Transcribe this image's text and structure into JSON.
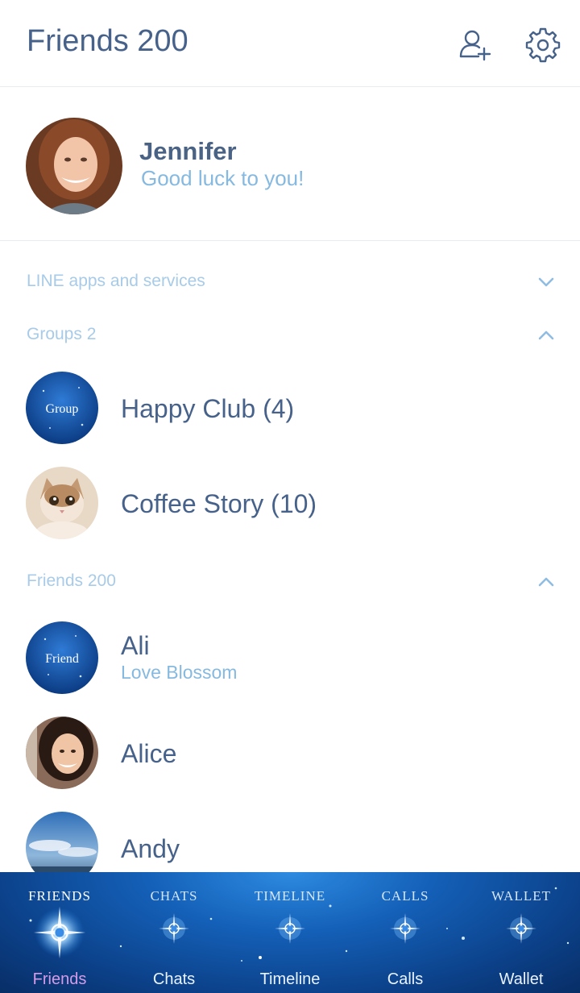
{
  "header": {
    "title": "Friends 200",
    "add_friend_icon": "person-add-icon",
    "settings_icon": "gear-icon"
  },
  "profile": {
    "name": "Jennifer",
    "status": "Good luck to you!"
  },
  "sections": {
    "apps": {
      "label": "LINE apps and services",
      "state": "collapsed"
    },
    "groups": {
      "label": "Groups 2",
      "state": "expanded"
    },
    "friends": {
      "label": "Friends 200",
      "state": "expanded"
    }
  },
  "groups": [
    {
      "name": "Happy Club (4)",
      "avatar_text": "Group"
    },
    {
      "name": "Coffee Story (10)",
      "avatar": "cat-photo"
    }
  ],
  "friends": [
    {
      "name": "Ali",
      "status": "Love Blossom",
      "avatar_text": "Friend"
    },
    {
      "name": "Alice",
      "status": "",
      "avatar": "person-photo"
    },
    {
      "name": "Andy",
      "status": "",
      "avatar": "sky-photo"
    }
  ],
  "tabs": [
    {
      "caps": "Friends",
      "label": "Friends",
      "active": true
    },
    {
      "caps": "Chats",
      "label": "Chats",
      "active": false
    },
    {
      "caps": "Timeline",
      "label": "Timeline",
      "active": false
    },
    {
      "caps": "Calls",
      "label": "Calls",
      "active": false
    },
    {
      "caps": "Wallet",
      "label": "Wallet",
      "active": false
    }
  ],
  "colors": {
    "text_primary": "#47628a",
    "text_secondary": "#86b9e0",
    "section_label": "#a7cbe8",
    "tabbar_blue": "#0b3f86",
    "active_tab_label": "#d59be6"
  }
}
